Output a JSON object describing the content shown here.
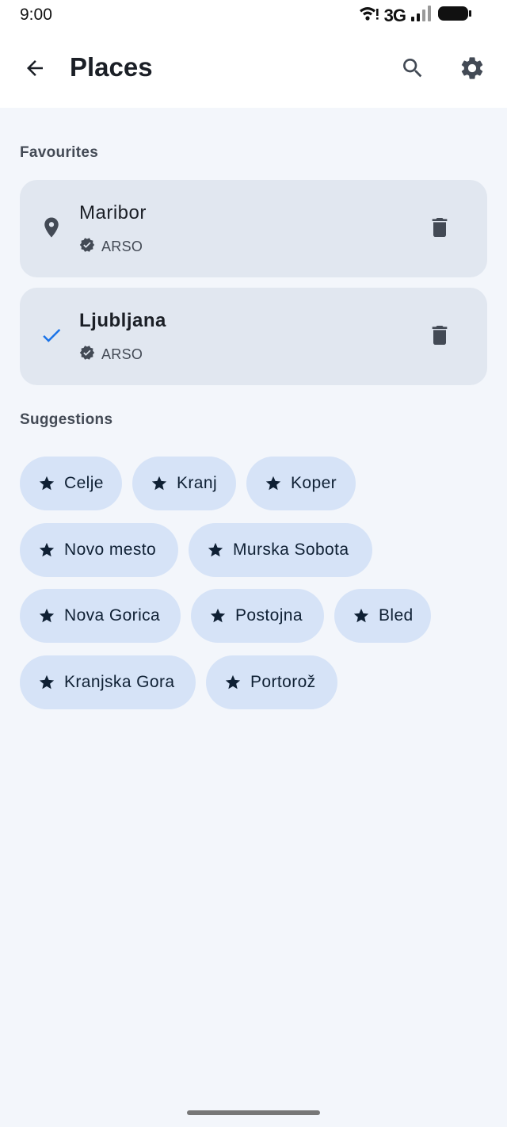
{
  "status_bar": {
    "time": "9:00",
    "network": "3G"
  },
  "app_bar": {
    "title": "Places"
  },
  "favourites": {
    "label": "Favourites",
    "items": [
      {
        "name": "Maribor",
        "source": "ARSO",
        "lead_icon": "location-pin-icon",
        "selected": false
      },
      {
        "name": "Ljubljana",
        "source": "ARSO",
        "lead_icon": "check-icon",
        "selected": true
      }
    ]
  },
  "suggestions": {
    "label": "Suggestions",
    "items": [
      "Celje",
      "Kranj",
      "Koper",
      "Novo mesto",
      "Murska Sobota",
      "Nova Gorica",
      "Postojna",
      "Bled",
      "Kranjska Gora",
      "Portorož"
    ]
  },
  "colors": {
    "accent": "#1a73e8",
    "chip_bg": "#d6e3f7",
    "card_bg": "#e1e7f0",
    "page_bg": "#f3f6fb"
  }
}
